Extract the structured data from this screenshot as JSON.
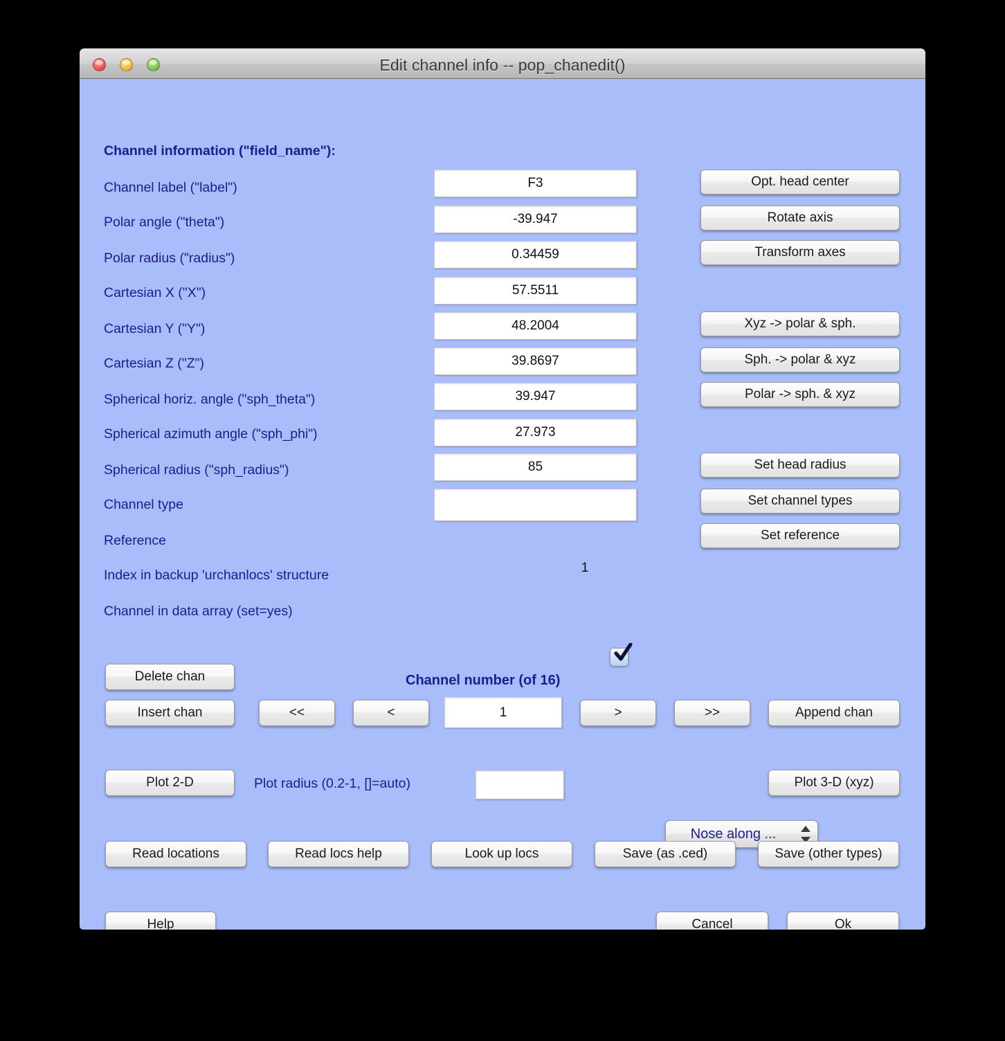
{
  "window": {
    "title": "Edit channel info -- pop_chanedit()",
    "traffic_lights": [
      "close",
      "minimize",
      "maximize"
    ],
    "background_color": "#a8bdfa",
    "label_color": "#1c1c8f"
  },
  "section_heading": "Channel information (\"field_name\"):",
  "fields": [
    {
      "label": "Channel label (\"label\")",
      "value": "F3"
    },
    {
      "label": "Polar angle (\"theta\")",
      "value": "-39.947"
    },
    {
      "label": "Polar radius (\"radius\")",
      "value": "0.34459"
    },
    {
      "label": "Cartesian X (\"X\")",
      "value": "57.5511"
    },
    {
      "label": "Cartesian Y (\"Y\")",
      "value": "48.2004"
    },
    {
      "label": "Cartesian Z (\"Z\")",
      "value": "39.8697"
    },
    {
      "label": "Spherical horiz. angle (\"sph_theta\")",
      "value": "39.947"
    },
    {
      "label": "Spherical azimuth angle (\"sph_phi\")",
      "value": "27.973"
    },
    {
      "label": "Spherical radius (\"sph_radius\")",
      "value": "85"
    },
    {
      "label": "Channel type",
      "value": ""
    }
  ],
  "reference": {
    "label": "Reference",
    "value": ""
  },
  "index_backup": {
    "label": "Index in backup 'urchanlocs' structure",
    "value": "1"
  },
  "in_data_array": {
    "label": "Channel in data array (set=yes)",
    "checked": true
  },
  "side_buttons": {
    "group1": [
      "Opt. head center",
      "Rotate axis",
      "Transform axes"
    ],
    "group2": [
      "Xyz -> polar & sph.",
      "Sph. -> polar & xyz",
      "Polar -> sph. & xyz"
    ],
    "group3": [
      "Set head radius",
      "Set channel types",
      "Set reference"
    ]
  },
  "channel_nav": {
    "heading": "Channel number (of 16)",
    "delete_label": "Delete chan",
    "insert_label": "Insert chan",
    "first_label": "<<",
    "prev_label": "<",
    "number_value": "1",
    "next_label": ">",
    "last_label": ">>",
    "append_label": "Append chan"
  },
  "plot_row": {
    "plot2d_label": "Plot 2-D",
    "radius_label": "Plot radius (0.2-1, []=auto)",
    "radius_value": "",
    "nose_option": "Nose along ...",
    "plot3d_label": "Plot 3-D (xyz)"
  },
  "file_row": [
    "Read locations",
    "Read locs help",
    "Look up locs",
    "Save (as .ced)",
    "Save (other types)"
  ],
  "bottom_row": {
    "help_label": "Help",
    "cancel_label": "Cancel",
    "ok_label": "Ok"
  }
}
